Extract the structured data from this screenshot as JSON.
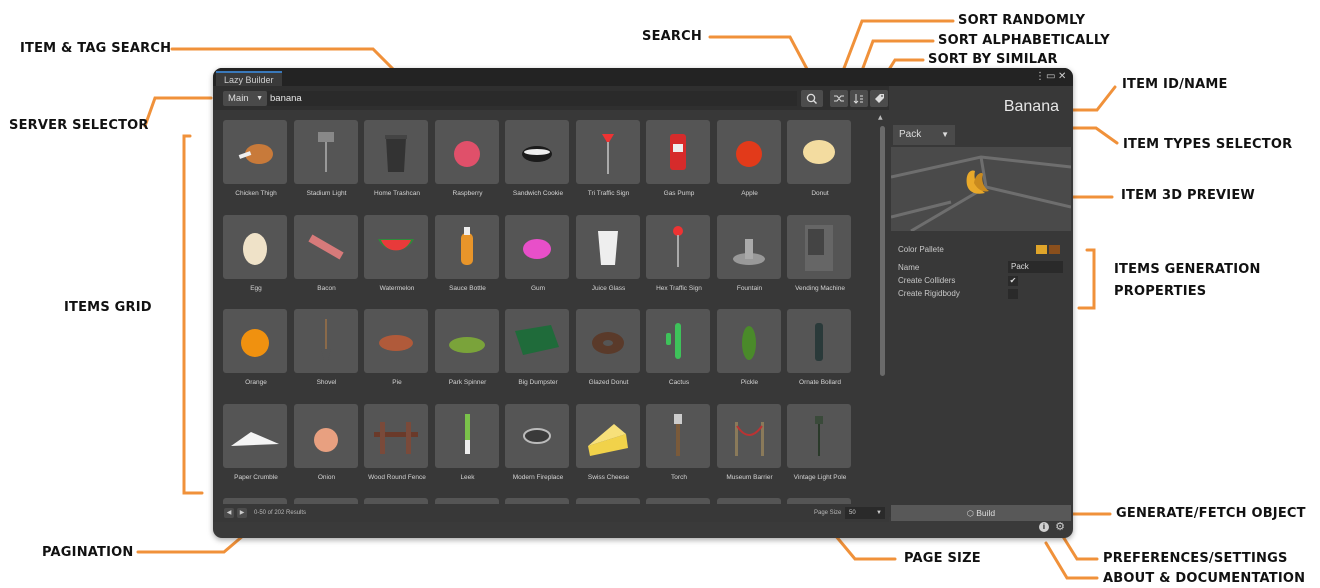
{
  "window": {
    "tab_title": "Lazy Builder"
  },
  "search": {
    "server": "Main",
    "query": "banana"
  },
  "items": [
    {
      "label": "Chicken Thigh",
      "icon": "chicken-thigh"
    },
    {
      "label": "Stadium Light",
      "icon": "stadium-light"
    },
    {
      "label": "Home Trashcan",
      "icon": "trashcan"
    },
    {
      "label": "Raspberry",
      "icon": "raspberry"
    },
    {
      "label": "Sandwich Cookie",
      "icon": "cookie"
    },
    {
      "label": "Tri Traffic Sign",
      "icon": "traffic-sign"
    },
    {
      "label": "Gas Pump",
      "icon": "gas-pump"
    },
    {
      "label": "Apple",
      "icon": "apple"
    },
    {
      "label": "Donut",
      "icon": "donut"
    },
    {
      "label": "Egg",
      "icon": "egg"
    },
    {
      "label": "Bacon",
      "icon": "bacon"
    },
    {
      "label": "Watermelon",
      "icon": "watermelon"
    },
    {
      "label": "Sauce Bottle",
      "icon": "sauce-bottle"
    },
    {
      "label": "Gum",
      "icon": "gum"
    },
    {
      "label": "Juice Glass",
      "icon": "juice-glass"
    },
    {
      "label": "Hex Traffic Sign",
      "icon": "hex-sign"
    },
    {
      "label": "Fountain",
      "icon": "fountain"
    },
    {
      "label": "Vending Machine",
      "icon": "vending-machine"
    },
    {
      "label": "Orange",
      "icon": "orange"
    },
    {
      "label": "Shovel",
      "icon": "shovel"
    },
    {
      "label": "Pie",
      "icon": "pie"
    },
    {
      "label": "Park Spinner",
      "icon": "park-spinner"
    },
    {
      "label": "Big Dumpster",
      "icon": "dumpster"
    },
    {
      "label": "Glazed Donut",
      "icon": "glazed-donut"
    },
    {
      "label": "Cactus",
      "icon": "cactus"
    },
    {
      "label": "Pickle",
      "icon": "pickle"
    },
    {
      "label": "Ornate Bollard",
      "icon": "bollard"
    },
    {
      "label": "Paper Crumble",
      "icon": "paper"
    },
    {
      "label": "Onion",
      "icon": "onion"
    },
    {
      "label": "Wood Round Fence",
      "icon": "fence"
    },
    {
      "label": "Leek",
      "icon": "leek"
    },
    {
      "label": "Modern Fireplace",
      "icon": "fireplace"
    },
    {
      "label": "Swiss Cheese",
      "icon": "cheese"
    },
    {
      "label": "Torch",
      "icon": "torch"
    },
    {
      "label": "Museum Barrier",
      "icon": "barrier"
    },
    {
      "label": "Vintage Light Pole",
      "icon": "light-pole"
    }
  ],
  "pagination": {
    "results_text": "0-50 of 202 Results",
    "page_size_label": "Page Size",
    "page_size": "50"
  },
  "details": {
    "item_name": "Banana",
    "item_type": "Pack",
    "color_palette_label": "Color Pallete",
    "palette_colors": [
      "#e0a52a",
      "#8a4f1c"
    ],
    "name_label": "Name",
    "name_value": "Pack",
    "create_colliders_label": "Create Colliders",
    "create_colliders": true,
    "create_rigidbody_label": "Create Rigidbody",
    "create_rigidbody": false,
    "build_label": "Build"
  },
  "callouts": {
    "item_tag_search": "ITEM & TAG SEARCH",
    "server_selector": "SERVER SELECTOR",
    "items_grid": "ITEMS GRID",
    "pagination": "PAGINATION",
    "search": "SEARCH",
    "sort_randomly": "SORT RANDOMLY",
    "sort_alphabetically": "SORT ALPHABETICALLY",
    "sort_by_similar": "SORT BY SIMILAR",
    "item_id_name": "ITEM ID/NAME",
    "item_types_selector": "ITEM TYPES SELECTOR",
    "item_3d_preview": "ITEM 3D PREVIEW",
    "items_generation_properties_1": "ITEMS GENERATION",
    "items_generation_properties_2": "PROPERTIES",
    "generate_fetch_object": "GENERATE/FETCH OBJECT",
    "page_size": "PAGE SIZE",
    "preferences_settings": "PREFERENCES/SETTINGS",
    "about_documentation": "ABOUT & DOCUMENTATION"
  },
  "accent_color": "#f0913a"
}
